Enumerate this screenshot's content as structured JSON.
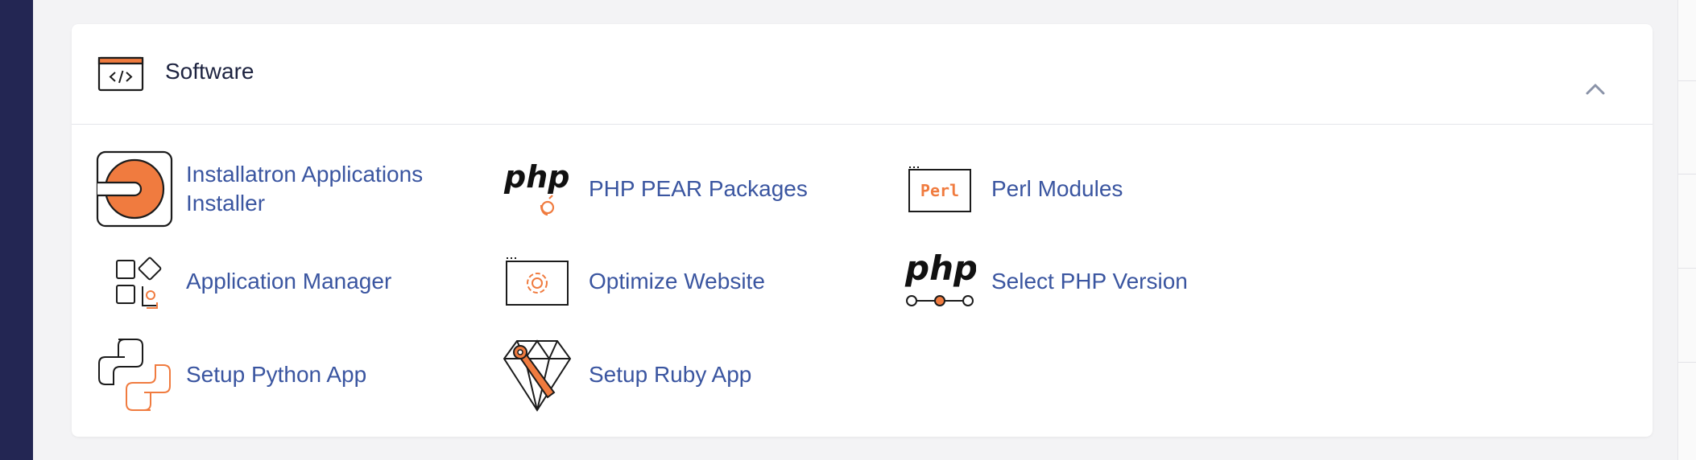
{
  "section": {
    "title": "Software",
    "icon": "code-window-icon",
    "collapse_icon": "chevron-up-icon"
  },
  "items": [
    {
      "label_line1": "Installatron Applications",
      "label_line2": "Installer",
      "icon": "installatron-icon"
    },
    {
      "label": "PHP PEAR Packages",
      "icon": "php-pear-icon"
    },
    {
      "label": "Perl Modules",
      "icon": "perl-icon",
      "icon_text": "Perl"
    },
    {
      "label": "Application Manager",
      "icon": "application-manager-icon"
    },
    {
      "label": "Optimize Website",
      "icon": "optimize-website-icon"
    },
    {
      "label": "Select PHP Version",
      "icon": "select-php-version-icon"
    },
    {
      "label": "Setup Python App",
      "icon": "python-icon"
    },
    {
      "label": "Setup Ruby App",
      "icon": "ruby-icon"
    }
  ],
  "icon_text": {
    "php": "php"
  },
  "colors": {
    "accent_orange": "#f07b3f",
    "link_blue": "#3a55a0",
    "sidebar": "#232653"
  }
}
